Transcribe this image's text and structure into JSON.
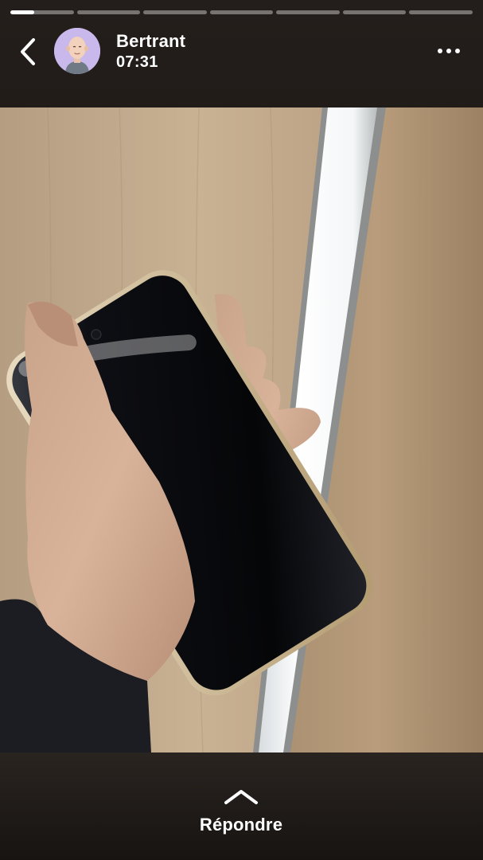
{
  "story": {
    "segments_total": 7,
    "current_segment": 1,
    "current_segment_progress": 0.38
  },
  "header": {
    "user_name": "Bertrant",
    "time": "07:31",
    "back_icon": "chevron-left-icon",
    "more_icon": "ellipsis-horizontal-icon"
  },
  "media": {
    "alt": "photo"
  },
  "footer": {
    "reply_label": "Répondre",
    "reply_icon": "chevron-up-icon"
  },
  "colors": {
    "bar_background": "#221c19",
    "avatar_background": "#c9b8ec",
    "text": "#ffffff"
  }
}
